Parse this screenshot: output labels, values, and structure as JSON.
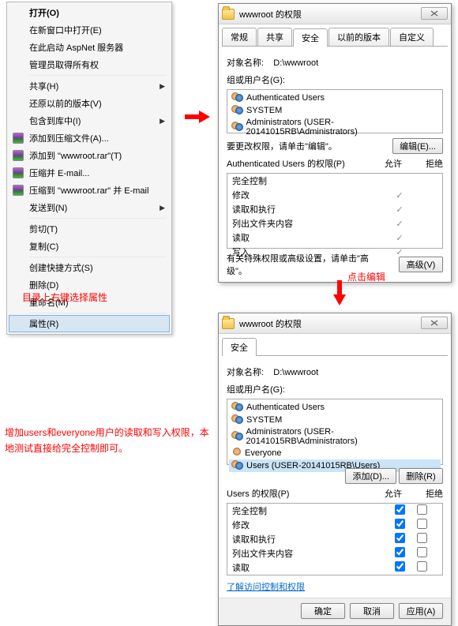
{
  "context_menu": {
    "items": [
      {
        "label": "打开(O)",
        "bold": true
      },
      {
        "label": "在新窗口中打开(E)"
      },
      {
        "label": "在此启动 AspNet 服务器"
      },
      {
        "label": "管理员取得所有权"
      },
      {
        "sep": true
      },
      {
        "label": "共享(H)",
        "arrow": true
      },
      {
        "label": "还原以前的版本(V)"
      },
      {
        "label": "包含到库中(I)",
        "arrow": true
      },
      {
        "label": "添加到压缩文件(A)...",
        "icon": "rar"
      },
      {
        "label": "添加到 \"wwwroot.rar\"(T)",
        "icon": "rar"
      },
      {
        "label": "压缩并 E-mail...",
        "icon": "rar"
      },
      {
        "label": "压缩到 \"wwwroot.rar\" 并 E-mail",
        "icon": "rar"
      },
      {
        "label": "发送到(N)",
        "arrow": true
      },
      {
        "sep": true
      },
      {
        "label": "剪切(T)"
      },
      {
        "label": "复制(C)"
      },
      {
        "sep": true
      },
      {
        "label": "创建快捷方式(S)"
      },
      {
        "label": "删除(D)"
      },
      {
        "label": "重命名(M)"
      },
      {
        "sep": true
      },
      {
        "label": "属性(R)",
        "highlighted": true
      }
    ]
  },
  "annotations": {
    "step1": "目录上右键选择属性",
    "step2": "点击编辑",
    "step3": "增加users和everyone用户的读取和写入权限，本地测试直接给完全控制即可。"
  },
  "dialog1": {
    "title": "wwwroot 的权限",
    "tabs": [
      "常规",
      "共享",
      "安全",
      "以前的版本",
      "自定义"
    ],
    "active_tab": 2,
    "object_label": "对象名称:",
    "object_value": "D:\\wwwroot",
    "group_label": "组或用户名(G):",
    "users": [
      {
        "name": "Authenticated Users",
        "type": "group"
      },
      {
        "name": "SYSTEM",
        "type": "group"
      },
      {
        "name": "Administrators (USER-20141015RB\\Administrators)",
        "type": "group"
      }
    ],
    "change_hint": "要更改权限，请单击\"编辑\"。",
    "edit_button": "编辑(E)...",
    "perm_header": "Authenticated Users 的权限(P)",
    "allow": "允许",
    "deny": "拒绝",
    "perms": [
      "完全控制",
      "修改",
      "读取和执行",
      "列出文件夹内容",
      "读取",
      "写入"
    ],
    "checks": [
      false,
      true,
      true,
      true,
      true,
      true
    ],
    "special_hint": "有关特殊权限或高级设置，请单击\"高级\"。",
    "advanced_button": "高级(V)"
  },
  "dialog2": {
    "title": "wwwroot 的权限",
    "tab": "安全",
    "object_label": "对象名称:",
    "object_value": "D:\\wwwroot",
    "group_label": "组或用户名(G):",
    "users": [
      {
        "name": "Authenticated Users"
      },
      {
        "name": "SYSTEM"
      },
      {
        "name": "Administrators (USER-20141015RB\\Administrators)"
      },
      {
        "name": "Everyone",
        "single": true
      },
      {
        "name": "Users (USER-20141015RB\\Users)",
        "selected": true
      }
    ],
    "add_button": "添加(D)...",
    "remove_button": "删除(R)",
    "perm_header": "Users 的权限(P)",
    "allow": "允许",
    "deny": "拒绝",
    "perms": [
      "完全控制",
      "修改",
      "读取和执行",
      "列出文件夹内容",
      "读取"
    ],
    "learn_link": "了解访问控制和权限",
    "ok": "确定",
    "cancel": "取消",
    "apply": "应用(A)"
  }
}
